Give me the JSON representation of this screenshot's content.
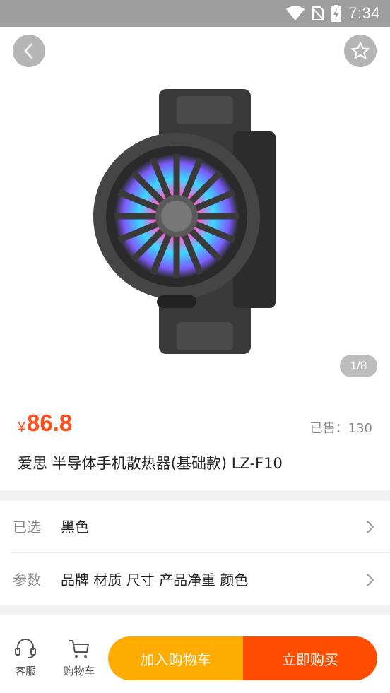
{
  "status_bar": {
    "time": "7:34",
    "icons": [
      "wifi-icon",
      "no-sim-icon",
      "battery-charging-icon"
    ]
  },
  "gallery": {
    "page_indicator": "1/8",
    "image_name": "semiconductor phone cooler"
  },
  "product": {
    "price_symbol": "¥",
    "price": "86.8",
    "sold": "已售：130",
    "title": "爱思 半导体手机散热器(基础款) LZ-F10"
  },
  "options": {
    "selected_label": "已选",
    "selected_value": "黑色",
    "params_label": "参数",
    "params_value": "品牌 材质 尺寸 产品净重 颜色"
  },
  "bottom_bar": {
    "customer_service": "客服",
    "cart": "购物车",
    "add_to_cart": "加入购物车",
    "buy_now": "立即购买"
  },
  "colors": {
    "accent_orange": "#ff4d00",
    "accent_yellow": "#ffab00",
    "status_bar": "#9e9e9e"
  }
}
